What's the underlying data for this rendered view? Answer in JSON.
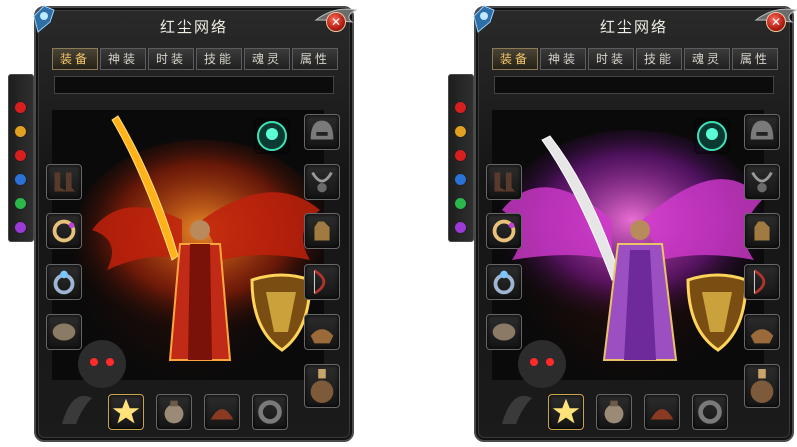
{
  "windows": [
    {
      "id": "left",
      "title": "红尘网络",
      "close_label": "✕",
      "tabs": [
        "装备",
        "神装",
        "时装",
        "技能",
        "魂灵",
        "属性"
      ],
      "active_tab": "装备",
      "aura_color": "#ff5a14",
      "robe_color": "#d2321e"
    },
    {
      "id": "right",
      "title": "红尘网络",
      "close_label": "✕",
      "tabs": [
        "装备",
        "神装",
        "时装",
        "技能",
        "魂灵",
        "属性"
      ],
      "active_tab": "装备",
      "aura_color": "#e34ad8",
      "robe_color": "#a95ec0"
    }
  ],
  "side_gems": [
    "#d81e1e",
    "#e0a020",
    "#d81e1e",
    "#2a72d8",
    "#2bb84a",
    "#9c3ad8"
  ],
  "equipment_slots": {
    "left_column": [
      "boots-icon",
      "bracelet-icon",
      "ring-icon",
      "belt-icon"
    ],
    "right_column": [
      "helmet-icon",
      "necklace-icon",
      "glove-icon",
      "bow-icon",
      "armor-piece-icon",
      "potion-icon"
    ],
    "bottom_row": [
      "medal-icon",
      "charm-icon",
      "hat-icon",
      "ring-band-icon"
    ],
    "top_badge": "emerald-badge-icon"
  }
}
